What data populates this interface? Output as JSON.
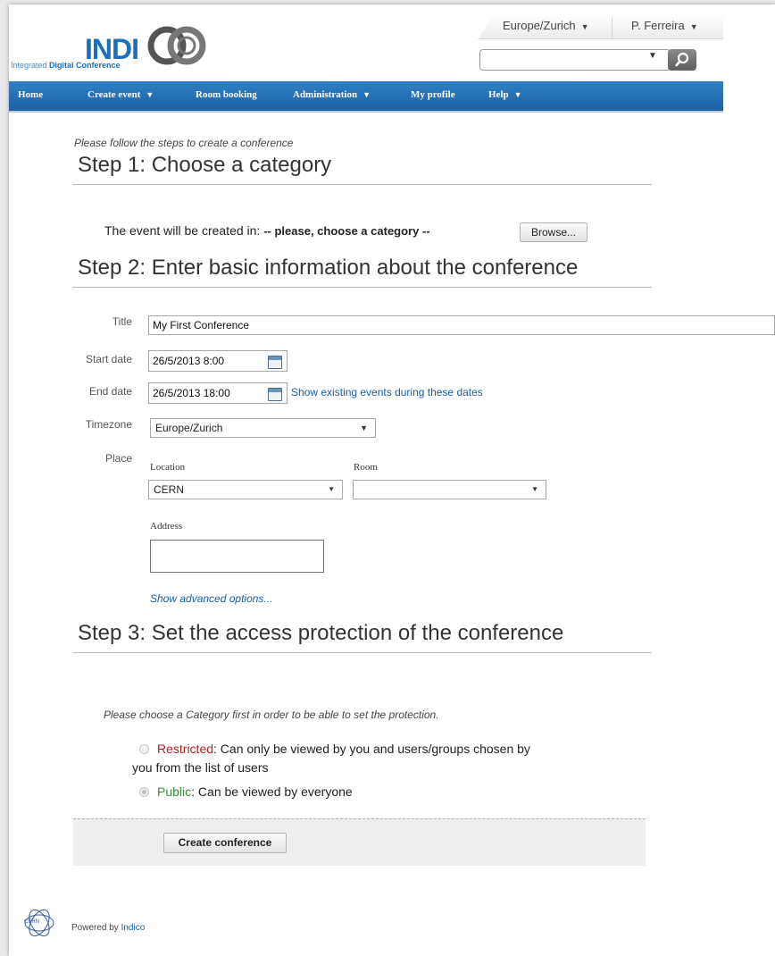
{
  "header": {
    "logo_word": "INDI",
    "logo_co": "CO",
    "logo_sub_light": "Integrated",
    "logo_sub_bold": "Digital Conference",
    "timezone_tab": "Europe/Zurich",
    "user_tab": "P. Ferreira",
    "search": {
      "value": "",
      "placeholder": ""
    }
  },
  "nav": {
    "home": "Home",
    "create_event": "Create event",
    "room_booking": "Room booking",
    "administration": "Administration",
    "my_profile": "My profile",
    "help": "Help"
  },
  "intro": "Please follow the steps to create a conference",
  "step1": {
    "title": "Step 1: Choose a category",
    "created_in_label": "The event will be created in:",
    "category_value": "-- please, choose a category --",
    "browse_button": "Browse..."
  },
  "step2": {
    "title": "Step 2: Enter basic information about the conference",
    "title_label": "Title",
    "title_value": "My First Conference",
    "start_label": "Start date",
    "start_value": "26/5/2013 8:00",
    "end_label": "End date",
    "end_value": "26/5/2013 18:00",
    "show_existing_link": "Show existing events during these dates",
    "timezone_label": "Timezone",
    "timezone_value": "Europe/Zurich",
    "place_label": "Place",
    "location_label": "Location",
    "location_value": "CERN",
    "room_label": "Room",
    "room_value": "",
    "address_label": "Address",
    "address_value": "",
    "advanced_link": "Show advanced options..."
  },
  "step3": {
    "title": "Step 3: Set the access protection of the conference",
    "note": "Please choose a Category first in order to be able to set the protection.",
    "restricted_label": "Restricted",
    "restricted_desc": ": Can only be viewed by you and users/groups chosen by",
    "restricted_desc2": "you from the list of users",
    "public_label": "Public",
    "public_desc": ": Can be viewed by everyone",
    "create_button": "Create conference"
  },
  "footer": {
    "powered_by": "Powered by",
    "powered_link": "Indico",
    "cern_logo_text": "CERN"
  }
}
